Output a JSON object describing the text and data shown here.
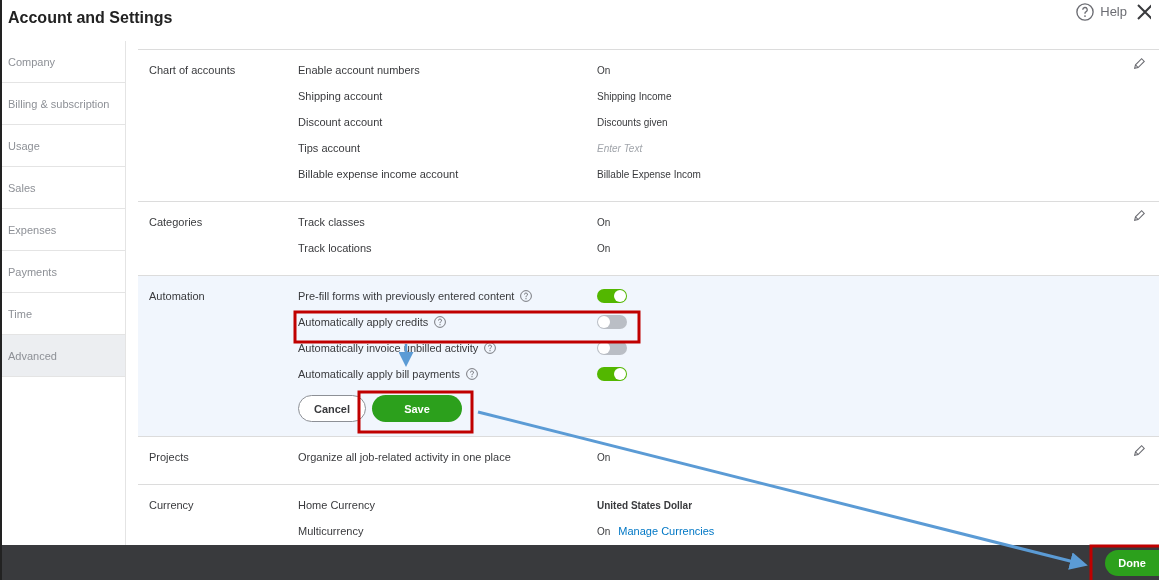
{
  "header": {
    "title": "Account and Settings",
    "help": "Help"
  },
  "sidebar": {
    "items": [
      {
        "label": "Company",
        "selected": false
      },
      {
        "label": "Billing & subscription",
        "selected": false
      },
      {
        "label": "Usage",
        "selected": false
      },
      {
        "label": "Sales",
        "selected": false
      },
      {
        "label": "Expenses",
        "selected": false
      },
      {
        "label": "Payments",
        "selected": false
      },
      {
        "label": "Time",
        "selected": false
      },
      {
        "label": "Advanced",
        "selected": true
      }
    ]
  },
  "sections": [
    {
      "title": "Chart of accounts",
      "editable": true,
      "highlighted": false,
      "rows": [
        {
          "kind": "text",
          "label": "Enable account numbers",
          "value": "On"
        },
        {
          "kind": "text",
          "label": "Shipping account",
          "value": "Shipping Income"
        },
        {
          "kind": "text",
          "label": "Discount account",
          "value": "Discounts given"
        },
        {
          "kind": "text",
          "label": "Tips account",
          "placeholder": "Enter Text"
        },
        {
          "kind": "text",
          "label": "Billable expense income account",
          "value": "Billable Expense Incom"
        }
      ]
    },
    {
      "title": "Categories",
      "editable": true,
      "highlighted": false,
      "rows": [
        {
          "kind": "text",
          "label": "Track classes",
          "value": "On"
        },
        {
          "kind": "text",
          "label": "Track locations",
          "value": "On"
        }
      ]
    },
    {
      "title": "Automation",
      "editable": false,
      "highlighted": true,
      "rows": [
        {
          "kind": "toggle",
          "label": "Pre-fill forms with previously entered content",
          "on": true
        },
        {
          "kind": "toggle",
          "label": "Automatically apply credits",
          "on": false
        },
        {
          "kind": "toggle",
          "label": "Automatically invoice unbilled activity",
          "on": false
        },
        {
          "kind": "toggle",
          "label": "Automatically apply bill payments",
          "on": true
        }
      ],
      "buttons": {
        "cancel": "Cancel",
        "save": "Save"
      }
    },
    {
      "title": "Projects",
      "editable": true,
      "highlighted": false,
      "rows": [
        {
          "kind": "text",
          "label": "Organize all job-related activity in one place",
          "value": "On"
        }
      ]
    },
    {
      "title": "Currency",
      "editable": false,
      "highlighted": false,
      "rows": [
        {
          "kind": "text",
          "label": "Home Currency",
          "value": "United States Dollar",
          "strong": true
        },
        {
          "kind": "text",
          "label": "Multicurrency",
          "value": "On",
          "link": "Manage Currencies"
        }
      ]
    }
  ],
  "footer": {
    "done": "Done"
  }
}
